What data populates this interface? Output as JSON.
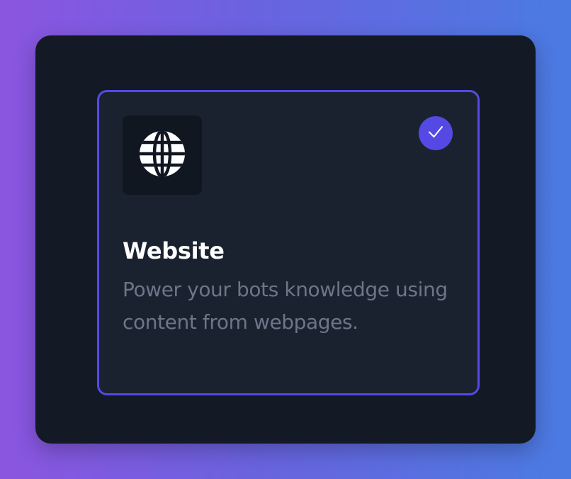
{
  "card": {
    "title": "Website",
    "description": "Power your bots knowledge using content from webpages.",
    "selected": true
  },
  "icons": {
    "source": "globe-icon",
    "selection": "check-icon"
  },
  "colors": {
    "background_start": "#8b55e0",
    "background_end": "#4a7be2",
    "panel": "#131a26",
    "card": "#1a2230",
    "accent": "#5549e6",
    "title": "#ffffff",
    "description": "#6c7687"
  }
}
